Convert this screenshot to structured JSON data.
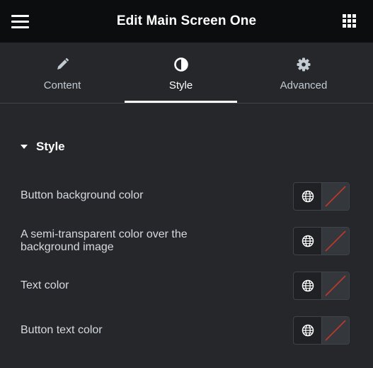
{
  "header": {
    "title": "Edit Main Screen One",
    "menu_icon": "hamburger-menu-icon",
    "apps_icon": "grid-apps-icon"
  },
  "tabs": [
    {
      "label": "Content",
      "icon": "pencil-icon",
      "active": false
    },
    {
      "label": "Style",
      "icon": "half-circle-contrast-icon",
      "active": true
    },
    {
      "label": "Advanced",
      "icon": "gear-icon",
      "active": false
    }
  ],
  "section": {
    "title": "Style",
    "expanded": true
  },
  "controls": [
    {
      "label": "Button background color"
    },
    {
      "label": "A semi-transparent color over the background image"
    },
    {
      "label": "Text color"
    },
    {
      "label": "Button text color"
    }
  ],
  "colors": {
    "header_bg": "#0c0d0e",
    "panel_bg": "#26272b",
    "swatch_empty": "#34383c",
    "empty_slash": "#c0392b",
    "text": "#d5dadf"
  }
}
